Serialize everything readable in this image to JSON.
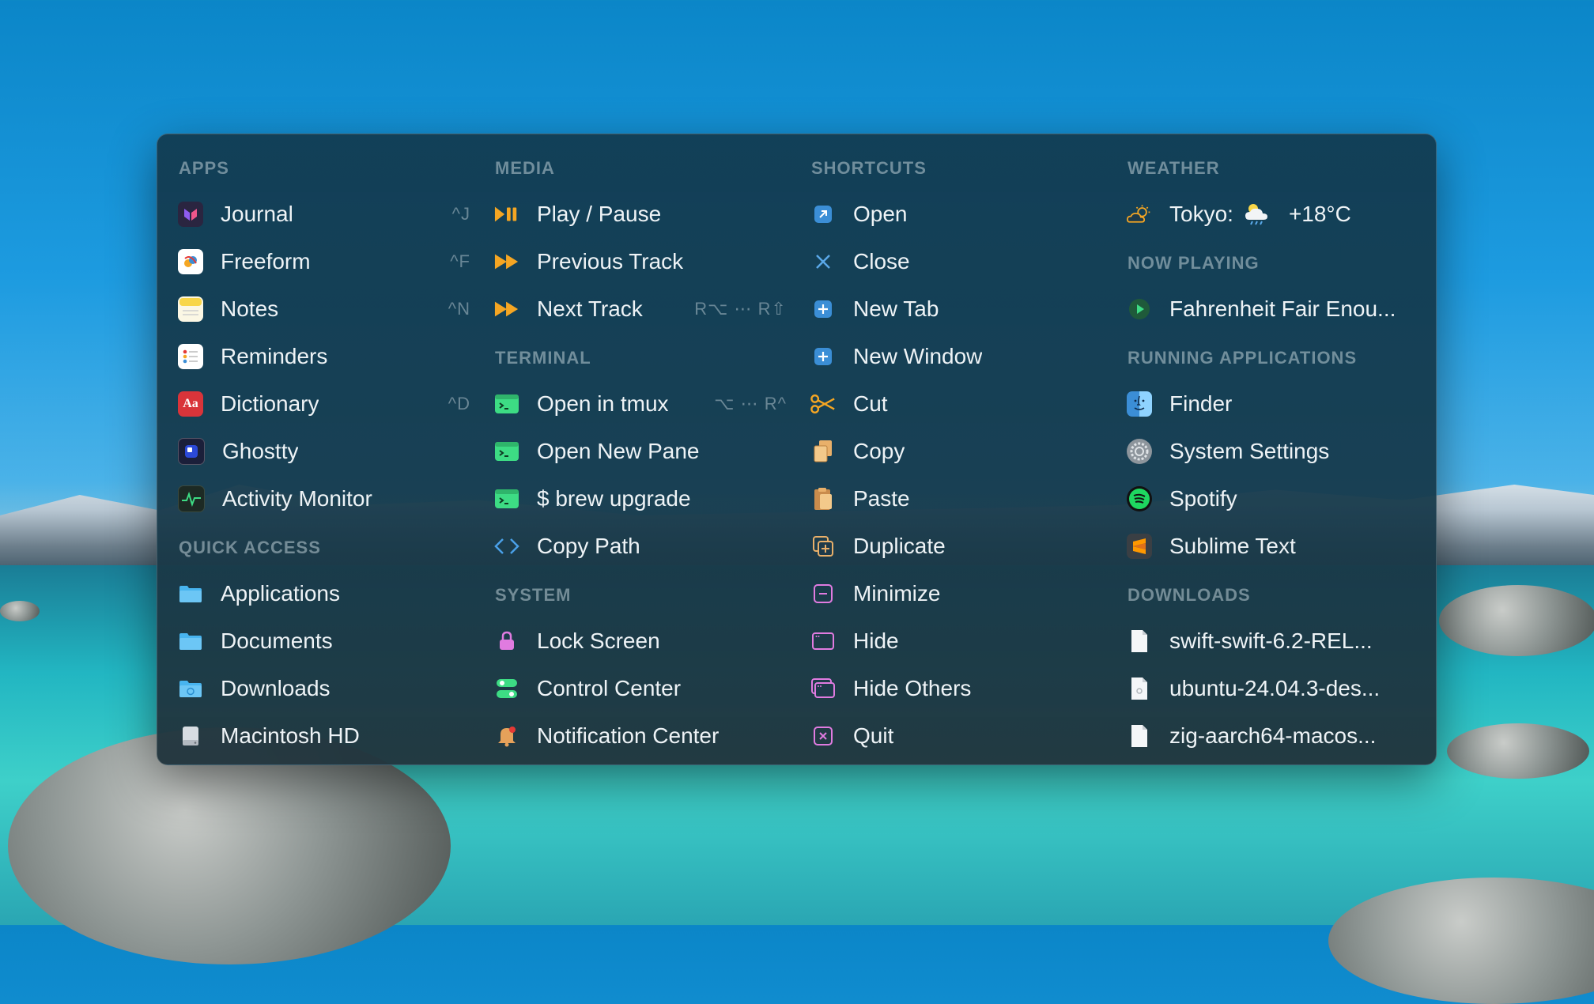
{
  "columns": {
    "apps": {
      "header": "APPS",
      "items": [
        {
          "label": "Journal",
          "shortcut": "^J",
          "icon": "journal-icon"
        },
        {
          "label": "Freeform",
          "shortcut": "^F",
          "icon": "freeform-icon"
        },
        {
          "label": "Notes",
          "shortcut": "^N",
          "icon": "notes-icon"
        },
        {
          "label": "Reminders",
          "shortcut": "",
          "icon": "reminders-icon"
        },
        {
          "label": "Dictionary",
          "shortcut": "^D",
          "icon": "dictionary-icon"
        },
        {
          "label": "Ghostty",
          "shortcut": "",
          "icon": "ghostty-icon"
        },
        {
          "label": "Activity Monitor",
          "shortcut": "",
          "icon": "activity-monitor-icon"
        }
      ]
    },
    "quick_access": {
      "header": "QUICK ACCESS",
      "items": [
        {
          "label": "Applications",
          "icon": "folder-icon"
        },
        {
          "label": "Documents",
          "icon": "folder-icon"
        },
        {
          "label": "Downloads",
          "icon": "folder-icon"
        },
        {
          "label": "Macintosh HD",
          "icon": "disk-icon"
        }
      ]
    },
    "media": {
      "header": "MEDIA",
      "items": [
        {
          "label": "Play / Pause",
          "shortcut": "",
          "icon": "play-pause-icon"
        },
        {
          "label": "Previous Track",
          "shortcut": "",
          "icon": "fast-forward-icon"
        },
        {
          "label": "Next Track",
          "shortcut": "R⌥ ⋯ R⇧",
          "icon": "fast-forward-icon"
        }
      ]
    },
    "terminal": {
      "header": "TERMINAL",
      "items": [
        {
          "label": "Open in tmux",
          "shortcut": "⌥ ⋯ R^",
          "icon": "terminal-icon"
        },
        {
          "label": "Open New Pane",
          "shortcut": "",
          "icon": "terminal-icon"
        },
        {
          "label": "$ brew upgrade",
          "shortcut": "",
          "icon": "terminal-icon"
        },
        {
          "label": "Copy Path",
          "shortcut": "",
          "icon": "code-icon"
        }
      ]
    },
    "system": {
      "header": "SYSTEM",
      "items": [
        {
          "label": "Lock Screen",
          "icon": "lock-icon"
        },
        {
          "label": "Control Center",
          "icon": "control-center-icon"
        },
        {
          "label": "Notification Center",
          "icon": "bell-icon"
        }
      ]
    },
    "shortcuts": {
      "header": "SHORTCUTS",
      "items": [
        {
          "label": "Open",
          "icon": "open-arrow-icon"
        },
        {
          "label": "Close",
          "icon": "close-icon"
        },
        {
          "label": "New Tab",
          "icon": "plus-icon"
        },
        {
          "label": "New Window",
          "icon": "plus-icon"
        },
        {
          "label": "Cut",
          "icon": "scissors-icon"
        },
        {
          "label": "Copy",
          "icon": "copy-icon"
        },
        {
          "label": "Paste",
          "icon": "paste-icon"
        },
        {
          "label": "Duplicate",
          "icon": "duplicate-icon"
        },
        {
          "label": "Minimize",
          "icon": "minimize-icon"
        },
        {
          "label": "Hide",
          "icon": "hide-icon"
        },
        {
          "label": "Hide Others",
          "icon": "hide-others-icon"
        },
        {
          "label": "Quit",
          "icon": "quit-icon"
        }
      ]
    },
    "weather": {
      "header": "WEATHER",
      "city": "Tokyo:",
      "temp": "+18°C"
    },
    "now_playing": {
      "header": "NOW PLAYING",
      "track": "Fahrenheit Fair Enou..."
    },
    "running": {
      "header": "RUNNING APPLICATIONS",
      "items": [
        {
          "label": "Finder",
          "icon": "finder-icon"
        },
        {
          "label": "System Settings",
          "icon": "system-settings-icon"
        },
        {
          "label": "Spotify",
          "icon": "spotify-icon"
        },
        {
          "label": "Sublime Text",
          "icon": "sublime-text-icon"
        }
      ]
    },
    "downloads": {
      "header": "DOWNLOADS",
      "items": [
        {
          "label": "swift-swift-6.2-REL...",
          "icon": "file-icon"
        },
        {
          "label": "ubuntu-24.04.3-des...",
          "icon": "file-icon"
        },
        {
          "label": "zig-aarch64-macos...",
          "icon": "file-icon"
        }
      ]
    }
  },
  "colors": {
    "accent_orange": "#f5a623",
    "terminal_green": "#3ddc84",
    "shortcut_blue": "#3b8ed6",
    "lock_pink": "#e07be0"
  }
}
